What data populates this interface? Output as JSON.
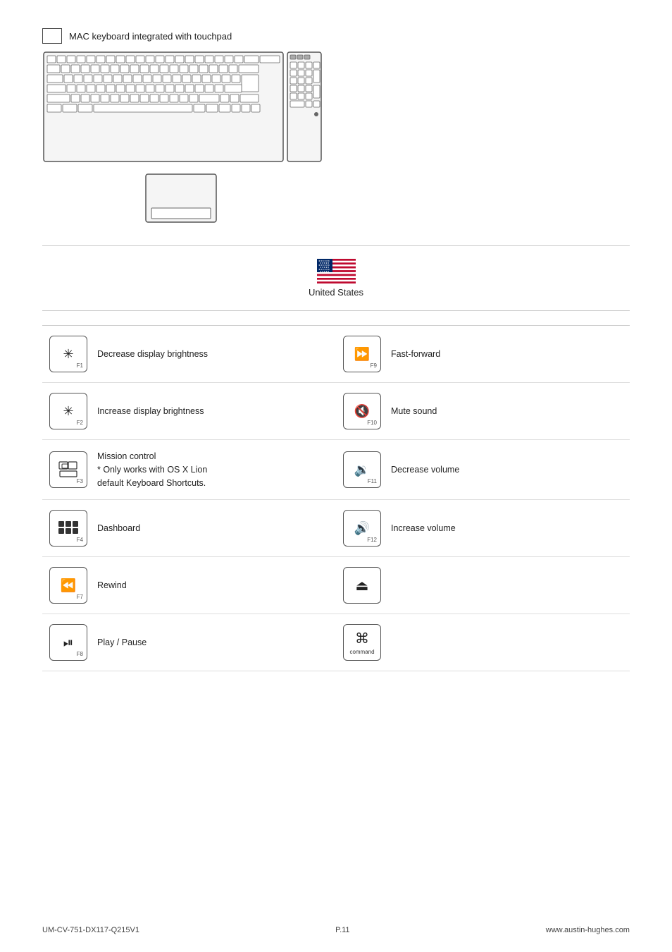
{
  "keyboard_section": {
    "label": "MAC keyboard integrated with touchpad"
  },
  "flag_section": {
    "country": "United States"
  },
  "shortcuts": [
    {
      "position": "left",
      "key_symbol": "✳",
      "fn_label": "F1",
      "description": "Decrease display brightness",
      "extra": ""
    },
    {
      "position": "right",
      "key_symbol": "▶▶",
      "fn_label": "F9",
      "description": "Fast-forward",
      "extra": ""
    },
    {
      "position": "left",
      "key_symbol": "✳",
      "fn_label": "F2",
      "description": "Increase display brightness",
      "extra": ""
    },
    {
      "position": "right",
      "key_symbol": "◀",
      "fn_label": "F10",
      "description": "Mute sound",
      "extra": ""
    },
    {
      "position": "left",
      "key_symbol": "mission",
      "fn_label": "F3",
      "description": "Mission control\n* Only works with OS X Lion\ndefault Keyboard Shortcuts.",
      "extra": ""
    },
    {
      "position": "right",
      "key_symbol": "🔉",
      "fn_label": "F11",
      "description": "Decrease volume",
      "extra": ""
    },
    {
      "position": "left",
      "key_symbol": "dashboard",
      "fn_label": "F4",
      "description": "Dashboard",
      "extra": ""
    },
    {
      "position": "right",
      "key_symbol": "🔊",
      "fn_label": "F12",
      "description": "Increase volume",
      "extra": ""
    },
    {
      "position": "left",
      "key_symbol": "◀◀",
      "fn_label": "F7",
      "description": "Rewind",
      "extra": ""
    },
    {
      "position": "right",
      "key_symbol": "⏏",
      "fn_label": "",
      "description": "",
      "extra": ""
    },
    {
      "position": "left",
      "key_symbol": "⏭",
      "fn_label": "F8",
      "description": "Play / Pause",
      "extra": ""
    },
    {
      "position": "right",
      "key_symbol": "cmd",
      "fn_label": "command",
      "description": "",
      "extra": ""
    }
  ],
  "footer": {
    "model": "UM-CV-751-DX117-Q215V1",
    "page": "P.11",
    "website": "www.austin-hughes.com"
  }
}
